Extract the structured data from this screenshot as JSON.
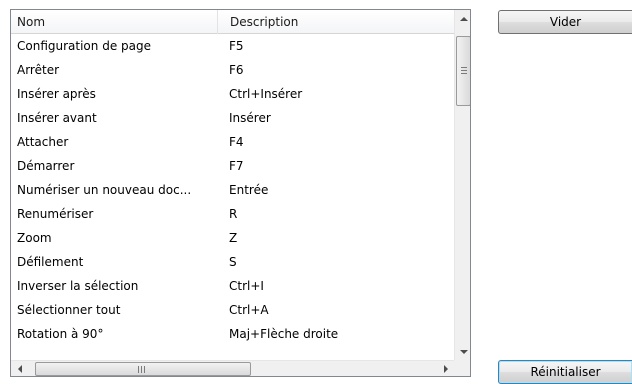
{
  "list": {
    "columns": [
      "Nom",
      "Description"
    ],
    "rows": [
      [
        "Configuration de page",
        "F5"
      ],
      [
        "Arrêter",
        "F6"
      ],
      [
        "Insérer après",
        "Ctrl+Insérer"
      ],
      [
        "Insérer avant",
        "Insérer"
      ],
      [
        "Attacher",
        "F4"
      ],
      [
        "Démarrer",
        "F7"
      ],
      [
        "Numériser un nouveau doc...",
        "Entrée"
      ],
      [
        "Renumériser",
        "R"
      ],
      [
        "Zoom",
        "Z"
      ],
      [
        "Défilement",
        "S"
      ],
      [
        "Inverser la sélection",
        "Ctrl+I"
      ],
      [
        "Sélectionner tout",
        "Ctrl+A"
      ],
      [
        "Rotation à 90°",
        "Maj+Flèche droite"
      ]
    ]
  },
  "buttons": {
    "clear_label": "Vider",
    "reset_label": "Réinitialiser"
  }
}
